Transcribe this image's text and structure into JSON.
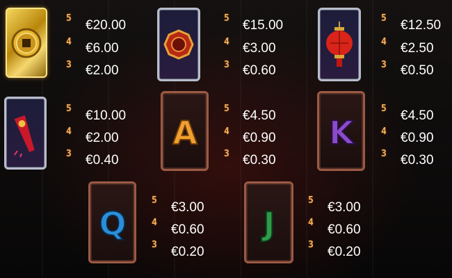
{
  "paytable": {
    "symbols": [
      {
        "id": "coin",
        "icon": "gold-coin-icon",
        "frame": "gold",
        "payouts": [
          "€20.00",
          "€6.00",
          "€2.00"
        ]
      },
      {
        "id": "amulet",
        "icon": "red-amulet-icon",
        "frame": "silver",
        "payouts": [
          "€15.00",
          "€3.00",
          "€0.60"
        ]
      },
      {
        "id": "lantern",
        "icon": "red-lantern-icon",
        "frame": "silver",
        "payouts": [
          "€12.50",
          "€2.50",
          "€0.50"
        ]
      },
      {
        "id": "firecracker",
        "icon": "firecracker-icon",
        "frame": "silver",
        "payouts": [
          "€10.00",
          "€2.00",
          "€0.40"
        ]
      },
      {
        "id": "A",
        "icon": "letter-a-icon",
        "frame": "bronze",
        "payouts": [
          "€4.50",
          "€0.90",
          "€0.30"
        ]
      },
      {
        "id": "K",
        "icon": "letter-k-icon",
        "frame": "bronze",
        "payouts": [
          "€4.50",
          "€0.90",
          "€0.30"
        ]
      },
      {
        "id": "Q",
        "icon": "letter-q-icon",
        "frame": "bronze",
        "payouts": [
          "€3.00",
          "€0.60",
          "€0.20"
        ]
      },
      {
        "id": "J",
        "icon": "letter-j-icon",
        "frame": "bronze",
        "payouts": [
          "€3.00",
          "€0.60",
          "€0.20"
        ]
      }
    ],
    "multipliers": [
      "5",
      "4",
      "3"
    ],
    "colors": {
      "multiplier": "#f4b25a",
      "value": "#ffffff",
      "letter_a": "#f0a030",
      "letter_k": "#8a4cc8",
      "letter_q": "#2a8fd8",
      "letter_j": "#2e9a4a"
    }
  }
}
